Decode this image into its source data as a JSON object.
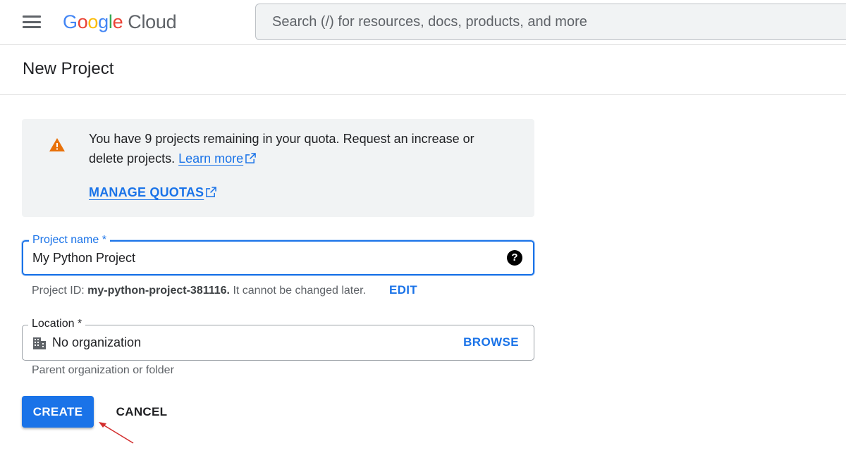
{
  "header": {
    "logo_letters": [
      "G",
      "o",
      "o",
      "g",
      "l",
      "e"
    ],
    "logo_product": "Cloud",
    "search_placeholder": "Search (/) for resources, docs, products, and more"
  },
  "page": {
    "title": "New Project"
  },
  "quota_notice": {
    "message": "You have 9 projects remaining in your quota. Request an increase or delete projects.",
    "learn_more": "Learn more",
    "manage_quotas": "MANAGE QUOTAS",
    "icon": "warning-icon",
    "icon_color": "#e8710a"
  },
  "project_name": {
    "label": "Project name *",
    "value": "My Python Project",
    "help_icon": "help-icon"
  },
  "project_id": {
    "prefix": "Project ID:",
    "id": "my-python-project-381116.",
    "suffix": "It cannot be changed later.",
    "edit_label": "EDIT"
  },
  "location": {
    "label": "Location *",
    "value": "No organization",
    "browse_label": "BROWSE",
    "icon": "organization-icon",
    "hint": "Parent organization or folder"
  },
  "actions": {
    "create_label": "CREATE",
    "cancel_label": "CANCEL"
  },
  "colors": {
    "accent": "#1a73e8",
    "annotation_arrow": "#d32f2f"
  }
}
